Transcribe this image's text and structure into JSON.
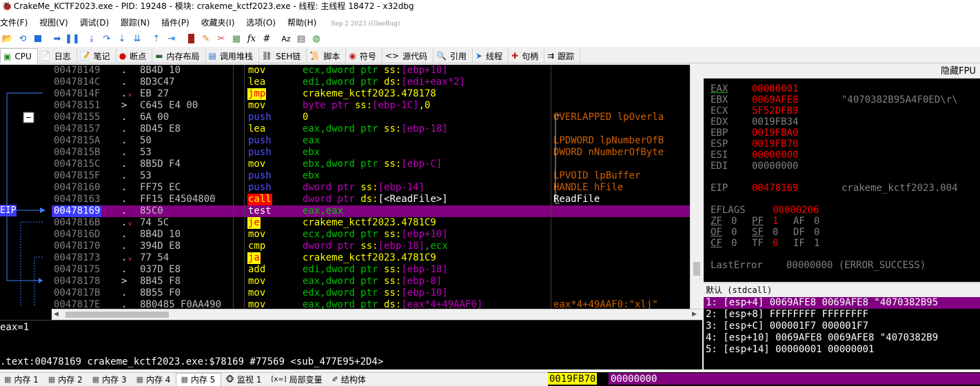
{
  "window": {
    "title": "CrakeMe_KCTF2023.exe - PID: 19248 - 模块: crakeme_kctf2023.exe - 线程: 主线程 18472 - x32dbg"
  },
  "menu": {
    "items": [
      "文件(F)",
      "视图(V)",
      "调试(D)",
      "跟踪(N)",
      "插件(P)",
      "收藏夹(I)",
      "选项(O)",
      "帮助(H)"
    ],
    "build": "Sep 2 2023 (GleeBug)"
  },
  "toolbar": {
    "icons": [
      "open-icon",
      "restart-icon",
      "stop-icon",
      "run-icon",
      "pause-icon",
      "step-into-icon",
      "step-over-icon",
      "step-into-trace-icon",
      "step-over-trace-icon",
      "run-to-user-icon",
      "execute-till-return-icon",
      "animate-icon",
      "comment-icon",
      "label-icon",
      "bookmark-icon",
      "function-icon",
      "hash-icon",
      "font-icon",
      "calculator-icon",
      "globe-icon"
    ]
  },
  "tabs": [
    {
      "label": "CPU",
      "icon": "cpu-icon",
      "active": true
    },
    {
      "label": "日志",
      "icon": "log-icon"
    },
    {
      "label": "笔记",
      "icon": "notes-icon"
    },
    {
      "label": "断点",
      "icon": "breakpoint-icon"
    },
    {
      "label": "内存布局",
      "icon": "memory-map-icon"
    },
    {
      "label": "调用堆栈",
      "icon": "call-stack-icon"
    },
    {
      "label": "SEH链",
      "icon": "seh-icon"
    },
    {
      "label": "脚本",
      "icon": "script-icon"
    },
    {
      "label": "符号",
      "icon": "symbols-icon"
    },
    {
      "label": "源代码",
      "icon": "source-icon"
    },
    {
      "label": "引用",
      "icon": "references-icon"
    },
    {
      "label": "线程",
      "icon": "threads-icon"
    },
    {
      "label": "句柄",
      "icon": "handles-icon"
    },
    {
      "label": "跟踪",
      "icon": "trace-icon"
    }
  ],
  "disasm": {
    "eip_label": "EIP",
    "rows": [
      {
        "addr": "00478149",
        "mark": ".",
        "bytes": "8B4D 10",
        "mnemonic": "mov",
        "mclass": "mov",
        "operands": [
          [
            "ecx,dword ptr ",
            "g"
          ],
          [
            "ss:",
            "y"
          ],
          [
            "[ebp+10]",
            "m"
          ]
        ],
        "comment": ""
      },
      {
        "addr": "0047814C",
        "mark": ".",
        "bytes": "8D3C47",
        "mnemonic": "lea",
        "mclass": "mov",
        "operands": [
          [
            "edi,dword ptr ",
            "g"
          ],
          [
            "ds:",
            "y"
          ],
          [
            "[edi+eax*2]",
            "m"
          ]
        ],
        "comment": ""
      },
      {
        "addr": "0047814F",
        "mark": ".v",
        "bytes": "EB 27",
        "mnemonic": "jmp",
        "mclass": "jmp",
        "operands": [
          [
            "crakeme_kctf2023.478178",
            "y"
          ]
        ],
        "comment": ""
      },
      {
        "addr": "00478151",
        "mark": ">",
        "bytes": "C645 E4 00",
        "mnemonic": "mov",
        "mclass": "mov",
        "operands": [
          [
            "byte ptr ",
            "m"
          ],
          [
            "ss:",
            "y"
          ],
          [
            "[ebp-1C]",
            "m"
          ],
          [
            ",0",
            "y"
          ]
        ],
        "comment": ""
      },
      {
        "addr": "00478155",
        "mark": ".",
        "bytes": "6A 00",
        "mnemonic": "push",
        "mclass": "push",
        "operands": [
          [
            "0",
            "y"
          ]
        ],
        "comment": "OVERLAPPED lpOverla"
      },
      {
        "addr": "00478157",
        "mark": ".",
        "bytes": "8D45 E8",
        "mnemonic": "lea",
        "mclass": "mov",
        "operands": [
          [
            "eax,dword ptr ",
            "g"
          ],
          [
            "ss:",
            "y"
          ],
          [
            "[ebp-18]",
            "m"
          ]
        ],
        "comment": ""
      },
      {
        "addr": "0047815A",
        "mark": ".",
        "bytes": "50",
        "mnemonic": "push",
        "mclass": "push",
        "operands": [
          [
            "eax",
            "g"
          ]
        ],
        "comment": "LPDWORD lpNumberOfB"
      },
      {
        "addr": "0047815B",
        "mark": ".",
        "bytes": "53",
        "mnemonic": "push",
        "mclass": "push",
        "operands": [
          [
            "ebx",
            "g"
          ]
        ],
        "comment": "DWORD nNumberOfByte"
      },
      {
        "addr": "0047815C",
        "mark": ".",
        "bytes": "8B5D F4",
        "mnemonic": "mov",
        "mclass": "mov",
        "operands": [
          [
            "ebx,dword ptr ",
            "g"
          ],
          [
            "ss:",
            "y"
          ],
          [
            "[ebp-C]",
            "m"
          ]
        ],
        "comment": ""
      },
      {
        "addr": "0047815F",
        "mark": ".",
        "bytes": "53",
        "mnemonic": "push",
        "mclass": "push",
        "operands": [
          [
            "ebx",
            "g"
          ]
        ],
        "comment": "LPVOID lpBuffer"
      },
      {
        "addr": "00478160",
        "mark": ".",
        "bytes": "FF75 EC",
        "mnemonic": "push",
        "mclass": "push",
        "operands": [
          [
            "dword ptr ",
            "m"
          ],
          [
            "ss:",
            "y"
          ],
          [
            "[ebp-14]",
            "m"
          ]
        ],
        "comment": "HANDLE hFile"
      },
      {
        "addr": "00478163",
        "mark": ".",
        "bytes": "FF15 E4504800",
        "mnemonic": "call",
        "mclass": "call",
        "operands": [
          [
            "dword ptr ",
            "m"
          ],
          [
            "ds:",
            "y"
          ],
          [
            "[<ReadFile>]",
            "w"
          ]
        ],
        "comment": "ReadFile"
      },
      {
        "addr": "00478169",
        "mark": ".",
        "bytes": "85C0",
        "mnemonic": "test",
        "mclass": "sel",
        "operands": [
          [
            "eax,eax",
            "s"
          ]
        ],
        "comment": "",
        "selected": true
      },
      {
        "addr": "0047816B",
        "mark": ".v",
        "bytes": "74 5C",
        "mnemonic": "je",
        "mclass": "jmp",
        "operands": [
          [
            "crakeme_kctf2023.4781C9",
            "y"
          ]
        ],
        "comment": ""
      },
      {
        "addr": "0047816D",
        "mark": ".",
        "bytes": "8B4D 10",
        "mnemonic": "mov",
        "mclass": "mov",
        "operands": [
          [
            "ecx,dword ptr ",
            "g"
          ],
          [
            "ss:",
            "y"
          ],
          [
            "[ebp+10]",
            "m"
          ]
        ],
        "comment": ""
      },
      {
        "addr": "00478170",
        "mark": ".",
        "bytes": "394D E8",
        "mnemonic": "cmp",
        "mclass": "mov",
        "operands": [
          [
            "dword ptr ",
            "m"
          ],
          [
            "ss:",
            "y"
          ],
          [
            "[ebp-18]",
            "m"
          ],
          [
            ",ecx",
            "g"
          ]
        ],
        "comment": ""
      },
      {
        "addr": "00478173",
        "mark": ".v",
        "bytes": "77 54",
        "mnemonic": "ja",
        "mclass": "jmp",
        "operands": [
          [
            "crakeme_kctf2023.4781C9",
            "y"
          ]
        ],
        "comment": ""
      },
      {
        "addr": "00478175",
        "mark": ".",
        "bytes": "037D E8",
        "mnemonic": "add",
        "mclass": "mov",
        "operands": [
          [
            "edi,dword ptr ",
            "g"
          ],
          [
            "ss:",
            "y"
          ],
          [
            "[ebp-18]",
            "m"
          ]
        ],
        "comment": ""
      },
      {
        "addr": "00478178",
        "mark": ">",
        "bytes": "8B45 F8",
        "mnemonic": "mov",
        "mclass": "mov",
        "operands": [
          [
            "eax,dword ptr ",
            "g"
          ],
          [
            "ss:",
            "y"
          ],
          [
            "[ebp-8]",
            "m"
          ]
        ],
        "comment": ""
      },
      {
        "addr": "0047817B",
        "mark": ".",
        "bytes": "8B55 F0",
        "mnemonic": "mov",
        "mclass": "mov",
        "operands": [
          [
            "edx,dword ptr ",
            "g"
          ],
          [
            "ss:",
            "y"
          ],
          [
            "[ebp-10]",
            "m"
          ]
        ],
        "comment": ""
      },
      {
        "addr": "0047817E",
        "mark": ".",
        "bytes": "8B0485 F0AA490",
        "mnemonic": "mov",
        "mclass": "mov",
        "operands": [
          [
            "eax,dword ptr ",
            "g"
          ],
          [
            "ds:",
            "y"
          ],
          [
            "[eax*4+49AAF0]",
            "m"
          ]
        ],
        "comment": "eax*4+49AAF0:\"xlj\"",
        "commentColor": "#d06000"
      }
    ]
  },
  "info": {
    "line1": "eax=1",
    "line2": ".text:00478169 crakeme_kctf2023.exe:$78169 #77569 <sub_477E95+2D4>"
  },
  "registers": {
    "header": "隐藏FPU",
    "gp": [
      {
        "name": "EAX",
        "value": "00000001",
        "changed": true,
        "str": "",
        "underline": true
      },
      {
        "name": "EBX",
        "value": "0069AFE8",
        "changed": true,
        "str": "\"4070382B95A4F0ED\\r\\"
      },
      {
        "name": "ECX",
        "value": "5F52DFB9",
        "changed": true,
        "str": ""
      },
      {
        "name": "EDX",
        "value": "0019FB34",
        "changed": false,
        "str": ""
      },
      {
        "name": "EBP",
        "value": "0019FBA0",
        "changed": true,
        "str": ""
      },
      {
        "name": "ESP",
        "value": "0019FB70",
        "changed": true,
        "str": ""
      },
      {
        "name": "ESI",
        "value": "00000000",
        "changed": true,
        "str": ""
      },
      {
        "name": "EDI",
        "value": "00000000",
        "changed": false,
        "str": ""
      }
    ],
    "eip": {
      "name": "EIP",
      "value": "00478169",
      "str": "crakeme_kctf2023.004"
    },
    "eflags": {
      "name": "EFLAGS",
      "value": "00000206"
    },
    "flags_rows": [
      [
        {
          "n": "ZF",
          "v": "0",
          "u": true
        },
        {
          "n": "PF",
          "v": "1",
          "changed": true,
          "u": true
        },
        {
          "n": "AF",
          "v": "0"
        }
      ],
      [
        {
          "n": "OF",
          "v": "0",
          "u": true
        },
        {
          "n": "SF",
          "v": "0",
          "u": true
        },
        {
          "n": "DF",
          "v": "0"
        }
      ],
      [
        {
          "n": "CF",
          "v": "0",
          "u": true
        },
        {
          "n": "TF",
          "v": "0",
          "changed": true
        },
        {
          "n": "IF",
          "v": "1"
        }
      ]
    ],
    "lasterror": {
      "name": "LastError",
      "value": "00000000 (ERROR_SUCCESS)"
    }
  },
  "stack": {
    "header": "默认 (stdcall)",
    "rows": [
      "1: [esp+4] 0069AFE8 0069AFE8 \"4070382B95",
      "2: [esp+8] FFFFFFFF FFFFFFFF",
      "3: [esp+C] 000001F7 000001F7",
      "4: [esp+10] 0069AFE8 0069AFE8 \"4070382B9",
      "5: [esp+14] 00000001 00000001"
    ]
  },
  "bottom_tabs": [
    {
      "label": "内存 1",
      "icon": "dump-icon"
    },
    {
      "label": "内存 2",
      "icon": "dump-icon"
    },
    {
      "label": "内存 3",
      "icon": "dump-icon"
    },
    {
      "label": "内存 4",
      "icon": "dump-icon"
    },
    {
      "label": "内存 5",
      "icon": "dump-icon",
      "active": true
    },
    {
      "label": "监视 1",
      "icon": "watch-icon"
    },
    {
      "label": "局部变量",
      "icon": "locals-icon",
      "prefix": "[x=]"
    },
    {
      "label": "结构体",
      "icon": "struct-icon"
    }
  ],
  "dump_strip": {
    "address": "0019FB70",
    "value": "00000000"
  },
  "colors": {
    "selection": "#800080",
    "eip_badge": "#3c3cff",
    "changed_reg": "#ff0000",
    "mn_mov": "#ffff00",
    "mn_push": "#5050ff",
    "mn_jmp": "#ffff00",
    "mn_call": "#ff0000",
    "op_general": "#00c000",
    "op_memory": "#c000c0",
    "op_prefix": "#ffff00",
    "comment": "#d06000"
  }
}
